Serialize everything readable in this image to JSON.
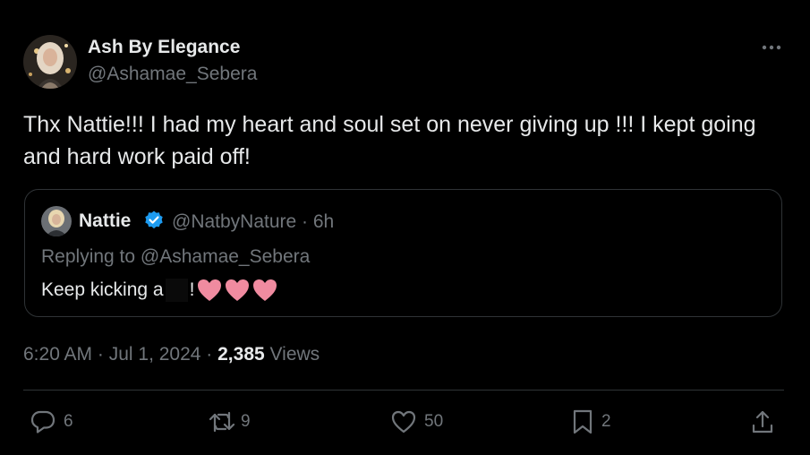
{
  "author": {
    "name": "Ash By Elegance",
    "handle": "@Ashamae_Sebera"
  },
  "more_icon": "more-horizontal-icon",
  "tweet_text": "Thx Nattie!!! I had my heart and soul set on never giving up !!! I kept going and hard work paid off!",
  "quote": {
    "name": "Nattie",
    "handle_time": "@NatbyNature · 6h",
    "replying_to": "Replying to @Ashamae_Sebera",
    "text_prefix": "Keep kicking a",
    "text_suffix": "!",
    "verified_icon": "verified-badge-icon",
    "emoji": [
      "pink-heart",
      "pink-heart",
      "pink-heart"
    ]
  },
  "meta": {
    "time_date": "6:20 AM · Jul 1, 2024 · ",
    "views_count": "2,385",
    "views_label": " Views"
  },
  "actions": {
    "replies": "6",
    "reposts": "9",
    "likes": "50",
    "bookmarks": "2"
  },
  "colors": {
    "background": "#000000",
    "text_primary": "#e7e9ea",
    "text_secondary": "#71767b",
    "border": "#2f3336",
    "verified": "#1d9bf0",
    "heart": "#f08ba0"
  }
}
